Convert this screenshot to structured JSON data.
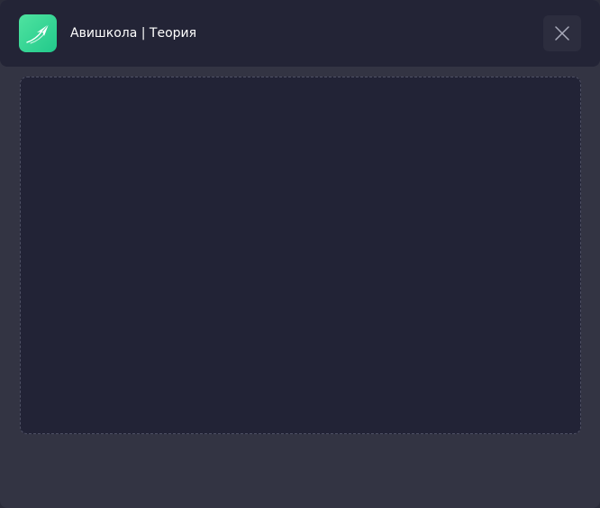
{
  "window": {
    "title": "Авишкола | Теория"
  },
  "icons": {
    "app": "paper-plane-icon",
    "close": "close-icon"
  },
  "colors": {
    "accent": "#2fd596",
    "header_bg": "#232436",
    "window_bg": "#333443",
    "content_bg": "#222336"
  }
}
